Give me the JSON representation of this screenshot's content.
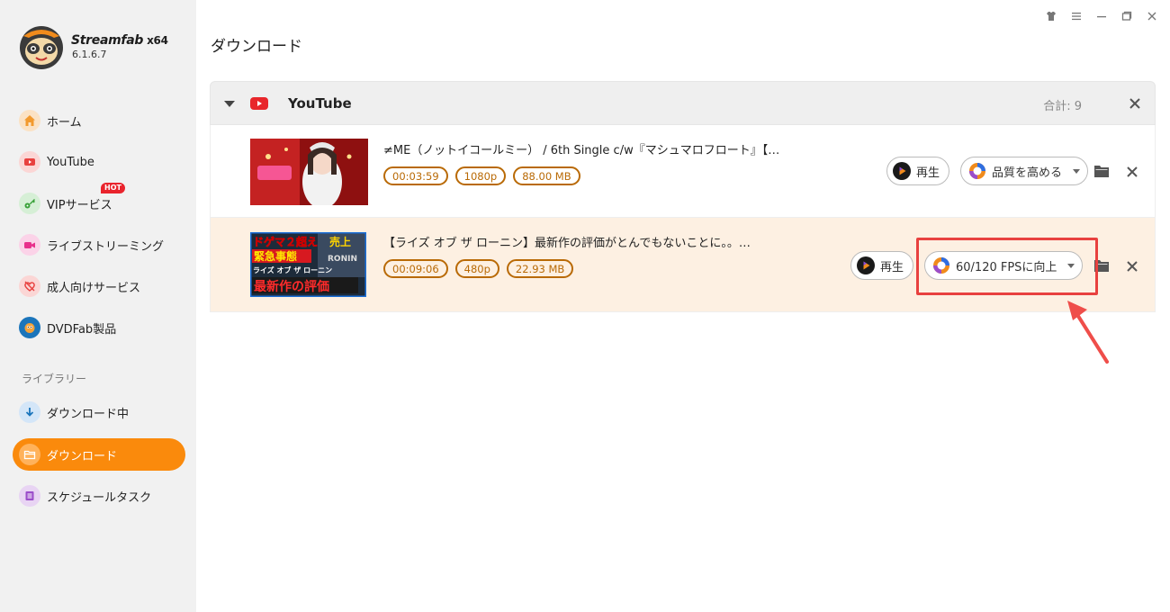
{
  "window": {
    "controls": [
      "skin-icon",
      "menu-icon",
      "minimize-icon",
      "restore-icon",
      "close-icon"
    ]
  },
  "brand": {
    "name": "Streamfab",
    "arch": "x64",
    "version": "6.1.6.7"
  },
  "sidebar": {
    "items": [
      {
        "label": "ホーム",
        "icon": "home-icon",
        "color": "#f5a33a"
      },
      {
        "label": "YouTube",
        "icon": "youtube-icon",
        "color": "#e8413f"
      },
      {
        "label": "VIPサービス",
        "icon": "key-icon",
        "color": "#3aa23a",
        "badge": "HOT"
      },
      {
        "label": "ライブストリーミング",
        "icon": "camera-icon",
        "color": "#e8308c"
      },
      {
        "label": "成人向けサービス",
        "icon": "adult-icon",
        "color": "#e8413f"
      },
      {
        "label": "DVDFab製品",
        "icon": "dvdfab-icon",
        "color": "#1b75bb"
      }
    ],
    "library_label": "ライブラリー",
    "library": [
      {
        "label": "ダウンロード中",
        "icon": "download-icon"
      },
      {
        "label": "ダウンロード",
        "icon": "folder-icon",
        "active": true
      },
      {
        "label": "スケジュールタスク",
        "icon": "schedule-icon"
      }
    ]
  },
  "page": {
    "title": "ダウンロード"
  },
  "group": {
    "name": "YouTube",
    "total": "合計: 9",
    "items": [
      {
        "title": "≠ME（ノットイコールミー） / 6th Single c/w『マシュマロフロート』【…",
        "duration": "00:03:59",
        "resolution": "1080p",
        "size": "88.00 MB",
        "play_label": "再生",
        "enhance_label": "品質を高める"
      },
      {
        "title": "【ライズ オブ ザ ローニン】最新作の評価がとんでもないことに。。…",
        "duration": "00:09:06",
        "resolution": "480p",
        "size": "22.93 MB",
        "play_label": "再生",
        "enhance_label": "60/120 FPSに向上",
        "thumb_text": [
          "ドゲマ２超え",
          "売上",
          "緊急事態",
          "ライズ オブ ザ ローニン",
          "最新作の評価",
          "RONIN"
        ]
      }
    ]
  },
  "colors": {
    "accent": "#fa8a0c",
    "tag": "#b96a06",
    "highlight": "#e8413f",
    "row_highlight_bg": "#fdf0e2"
  }
}
